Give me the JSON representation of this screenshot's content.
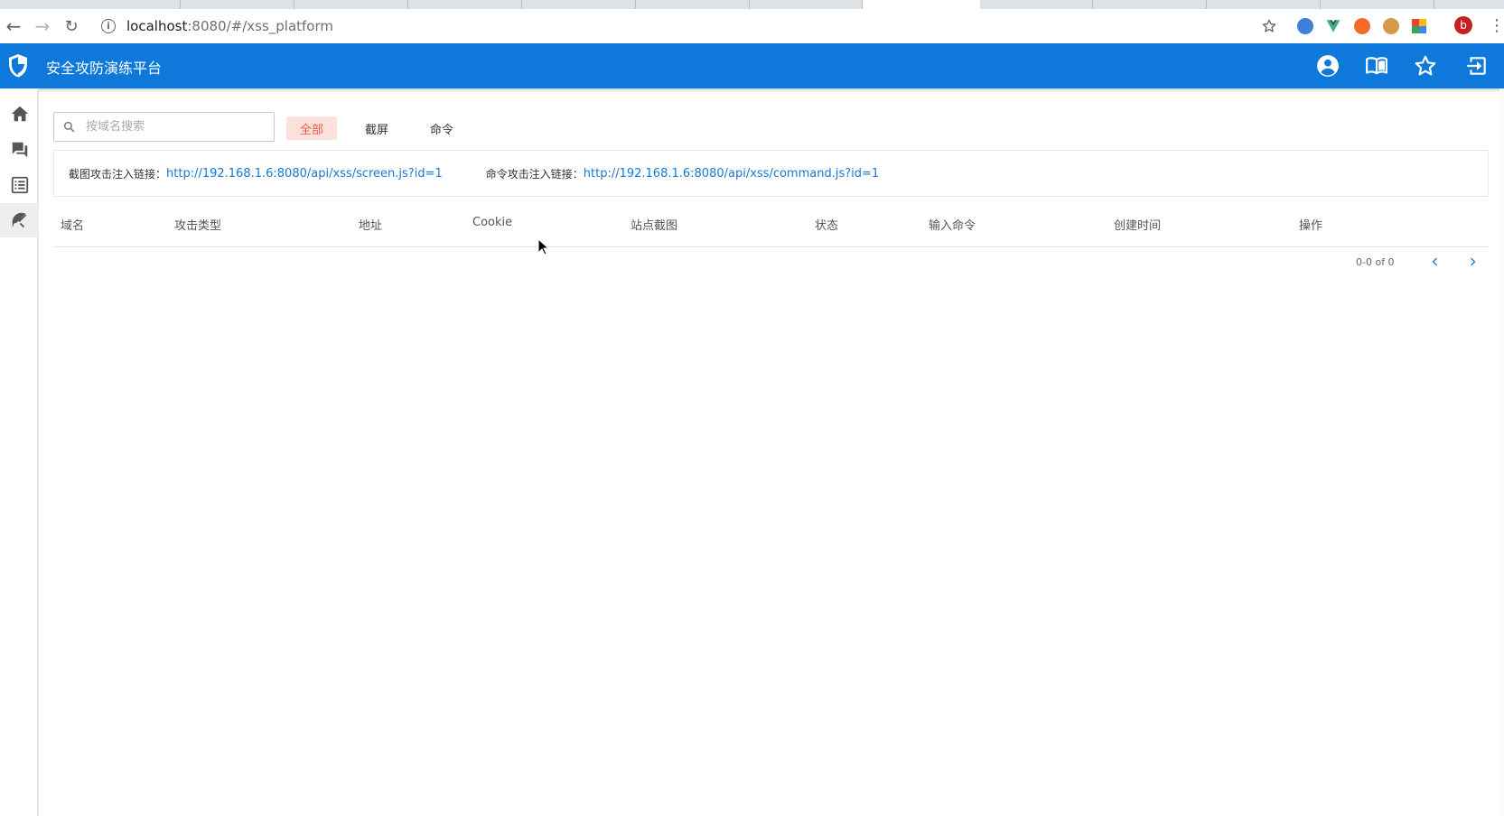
{
  "browser": {
    "url_host": "localhost",
    "url_rest": ":8080/#/xss_platform",
    "profile_initial": "b"
  },
  "app": {
    "title": "安全攻防演练平台",
    "brand_color": "#0e79db"
  },
  "sidebar": {
    "items": [
      {
        "icon": "home-icon"
      },
      {
        "icon": "forum-icon"
      },
      {
        "icon": "list-icon"
      },
      {
        "icon": "phishing-icon"
      }
    ]
  },
  "search": {
    "placeholder": "按域名搜索",
    "value": ""
  },
  "filters": [
    {
      "label": "全部",
      "active": true
    },
    {
      "label": "截屏",
      "active": false
    },
    {
      "label": "命令",
      "active": false
    }
  ],
  "links": {
    "screen_label": "截图攻击注入链接：",
    "screen_url": "http://192.168.1.6:8080/api/xss/screen.js?id=1",
    "command_label": "命令攻击注入链接：",
    "command_url": "http://192.168.1.6:8080/api/xss/command.js?id=1"
  },
  "table": {
    "columns": [
      "域名",
      "攻击类型",
      "地址",
      "Cookie",
      "站点截图",
      "状态",
      "输入命令",
      "创建时间",
      "操作"
    ],
    "rows": []
  },
  "pagination": {
    "range_text": "0-0 of 0"
  },
  "colors": {
    "accent": "#0e79db",
    "active_filter_bg": "#fde1dc",
    "active_filter_text": "#f05a3e",
    "link": "#1778d6"
  }
}
